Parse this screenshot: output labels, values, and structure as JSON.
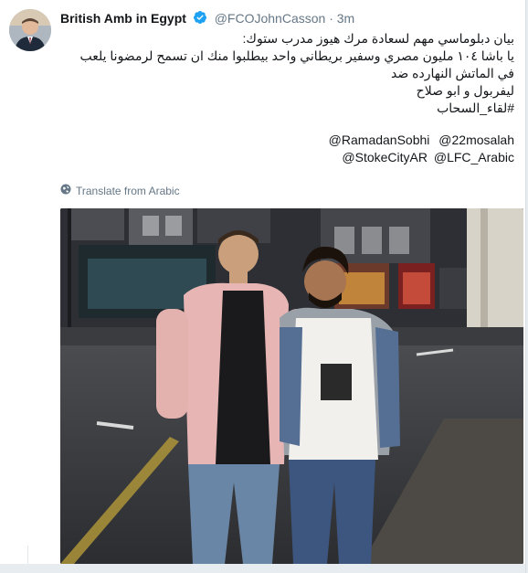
{
  "tweet": {
    "author_name": "British Amb in Egypt",
    "handle": "@FCOJohnCasson",
    "separator": "·",
    "time": "3m",
    "body_lines": [
      "بيان دبلوماسي مهم لسعادة مرك هيوز مدرب ستوك:",
      "يا باشا ١٠٤ مليون مصري وسفير بريطاني واحد بيطلبوا منك ان تسمح لرمضونا يلعب في الماتش النهارده  ضد",
      "ليفربول و ابو صلاح"
    ],
    "hashtag": "#لقاء_السحاب",
    "mention_lines": [
      [
        "@RamadanSobhi",
        "@22mosalah"
      ],
      [
        "@StokeCityAR",
        "@LFC_Arabic"
      ]
    ],
    "translate_label": "Translate from Arabic"
  },
  "icons": {
    "verified": "verified-badge-icon",
    "globe": "globe-icon"
  },
  "colors": {
    "background": "#e6ecf0",
    "card": "#ffffff",
    "verified_blue": "#1da1f2",
    "muted_text": "#657786"
  }
}
